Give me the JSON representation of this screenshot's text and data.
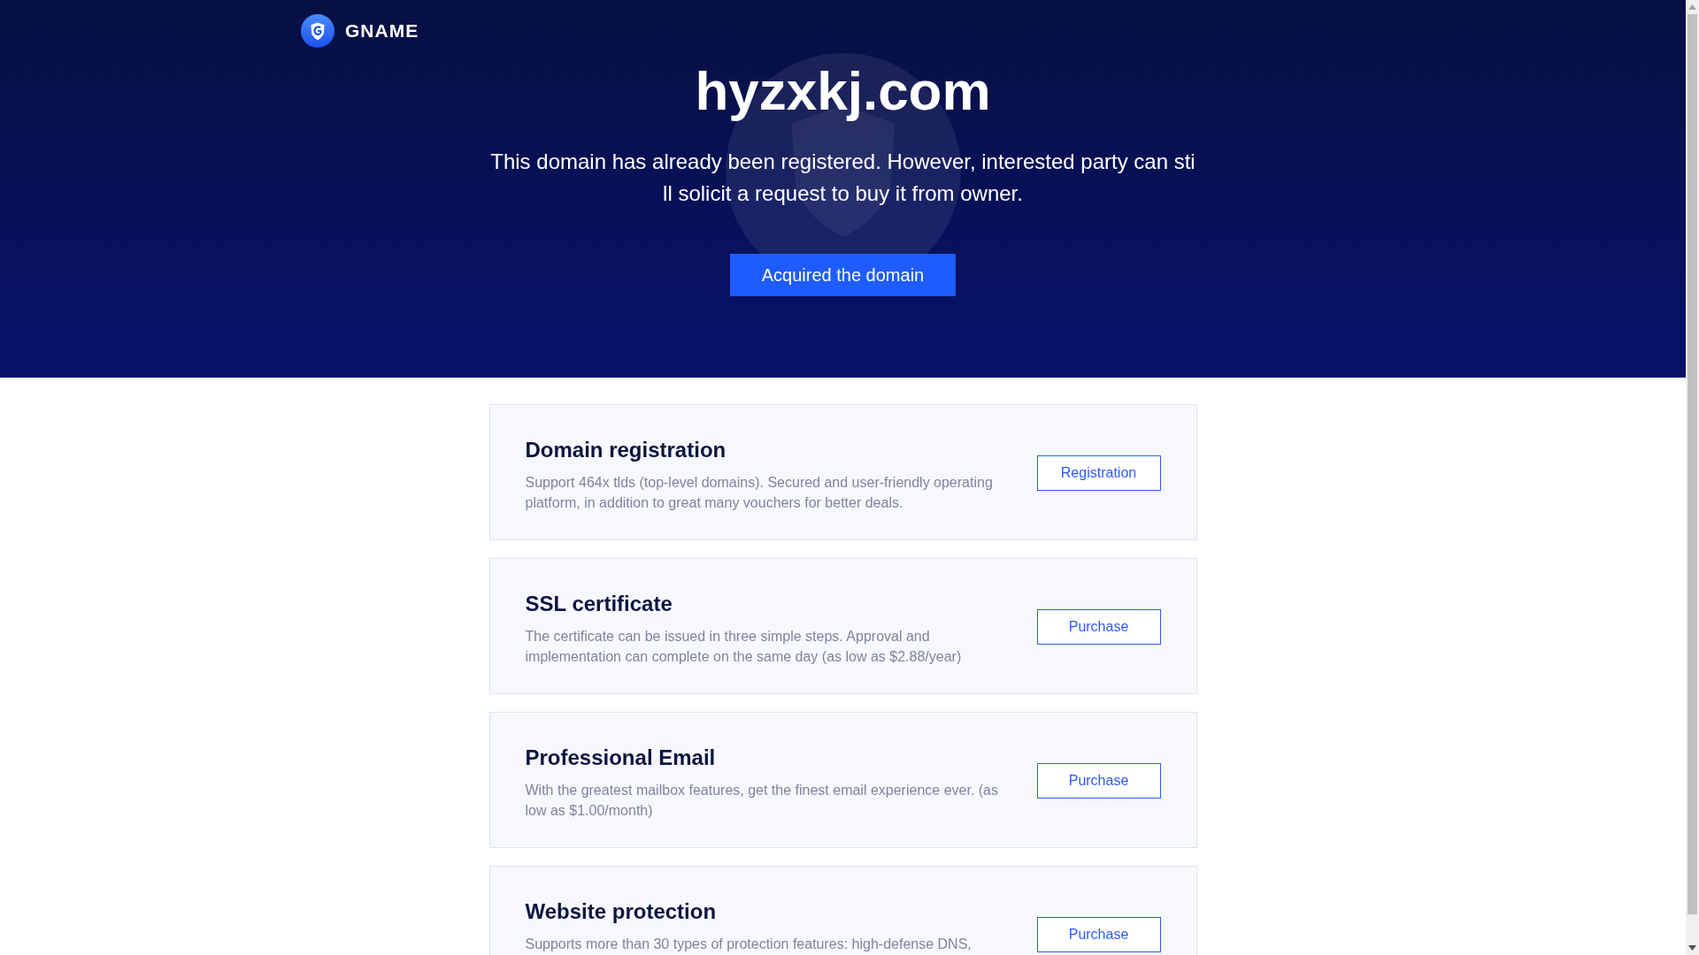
{
  "header": {
    "logo_text": "GNAME"
  },
  "hero": {
    "domain": "hyzxkj.com",
    "message": "This domain has already been registered. However, interested party can still solicit a request to buy it from owner.",
    "button": "Acquired the domain"
  },
  "services": [
    {
      "title": "Domain registration",
      "description": "Support 464x tlds (top-level domains). Secured and user-friendly operating platform, in addition to great many vouchers for better deals.",
      "button": "Registration"
    },
    {
      "title": "SSL certificate",
      "description": "The certificate can be issued in three simple steps. Approval and implementation can complete on the same day (as low as $2.88/year)",
      "button": "Purchase"
    },
    {
      "title": "Professional Email",
      "description": "With the greatest mailbox features, get the finest email experience ever. (as low as $1.00/month)",
      "button": "Purchase"
    },
    {
      "title": "Website protection",
      "description": "Supports more than 30 types of protection features: high-defense DNS,",
      "button": "Purchase"
    }
  ]
}
